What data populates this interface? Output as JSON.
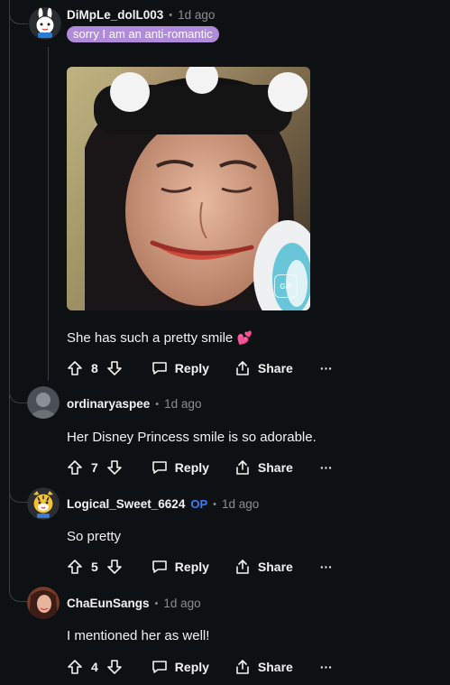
{
  "colors": {
    "background": "#0e1113",
    "accent_op": "#3d7cf5",
    "flair_bg": "#b08bd9",
    "meta": "#8a8f93"
  },
  "actions": {
    "reply_label": "Reply",
    "share_label": "Share",
    "more_label": "···"
  },
  "comments": [
    {
      "username": "DiMpLe_dolL003",
      "separator": "•",
      "time": "1d ago",
      "flair": "sorry I am an anti-romantic",
      "gif_badge": "GIF",
      "text": "She has such a pretty smile",
      "emoji": "💕",
      "votes": "8",
      "avatar_icon": "bunny-avatar-icon"
    },
    {
      "username": "ordinaryaspee",
      "separator": "•",
      "time": "1d ago",
      "text": "Her Disney Princess smile is so adorable.",
      "votes": "7",
      "avatar_icon": "photo-avatar-icon"
    },
    {
      "username": "Logical_Sweet_6624",
      "op_label": "OP",
      "separator": "•",
      "time": "1d ago",
      "text": "So pretty",
      "votes": "5",
      "avatar_icon": "tiger-avatar-icon"
    },
    {
      "username": "ChaEunSangs",
      "separator": "•",
      "time": "1d ago",
      "text": "I mentioned her as well!",
      "votes": "4",
      "avatar_icon": "photo-avatar-icon"
    }
  ]
}
